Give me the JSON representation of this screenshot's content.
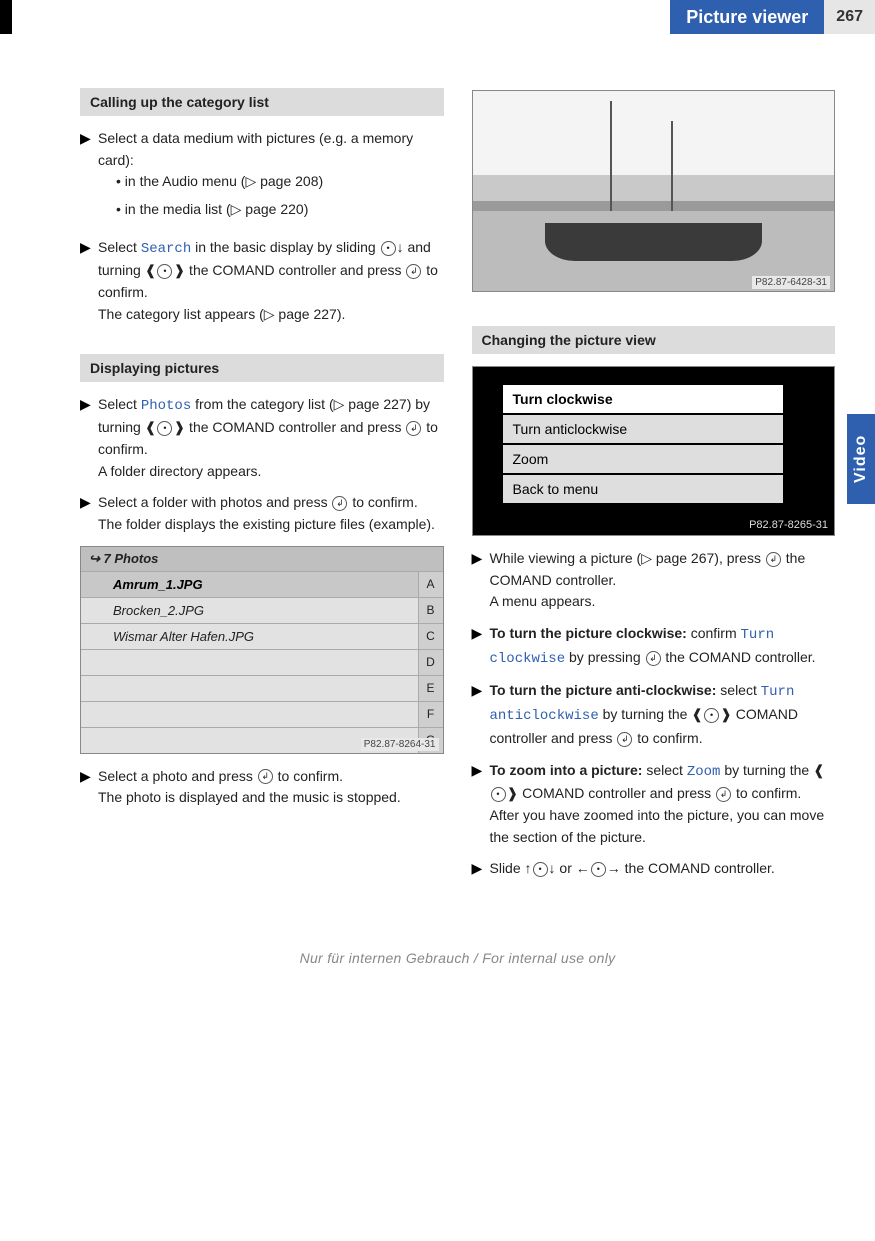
{
  "header": {
    "title": "Picture viewer",
    "page_number": "267"
  },
  "side_tab": "Video",
  "left": {
    "sec1": {
      "heading": "Calling up the category list",
      "step1a": "Select a data medium with pictures (e.g. a memory card):",
      "bullet1": "in the Audio menu (",
      "bullet1_ref": "page 208",
      "bullet2": "in the media list (",
      "bullet2_ref": "page 220",
      "step2_pre": "Select ",
      "step2_menu": "Search",
      "step2_post": " in the basic display by slid­ing ",
      "step2_post2": " and turning ",
      "step2_post3": " the COMAND controller and press ",
      "step2_post4": " to confirm.",
      "step2_result_pre": "The category list appears (",
      "step2_result_ref": "page 227",
      "step2_result_post": ")."
    },
    "sec2": {
      "heading": "Displaying pictures",
      "s1_pre": "Select ",
      "s1_menu": "Photos",
      "s1_mid": " from the category list (",
      "s1_ref": "page 227",
      "s1_post": ") by turning ",
      "s1_post2": " the COMAND controller and press ",
      "s1_post3": " to confirm.",
      "s1_res": "A folder directory appears.",
      "s2": "Select a folder with photos and press ",
      "s2_post": " to confirm.",
      "s2_res": "The folder displays the existing picture files (example).",
      "shot_caption": "P82.87-8264-31",
      "list_header": "7 Photos",
      "files": [
        "Amrum_1.JPG",
        "Brocken_2.JPG",
        "Wismar Alter Hafen.JPG"
      ],
      "letters": [
        "A",
        "B",
        "C",
        "D",
        "E",
        "F",
        "G"
      ],
      "s3": "Select a photo and press ",
      "s3_post": " to confirm.",
      "s3_res": "The photo is displayed and the music is stopped."
    }
  },
  "right": {
    "shot1_caption": "P82.87-6428-31",
    "sec": {
      "heading": "Changing the picture view",
      "menu_items": [
        "Turn clockwise",
        "Turn anticlockwise",
        "Zoom",
        "Back to menu"
      ],
      "shot2_caption": "P82.87-8265-31",
      "s1_pre": "While viewing a picture (",
      "s1_ref": "page 267",
      "s1_post": "), press ",
      "s1_post2": " the COMAND controller.",
      "s1_res": "A menu appears.",
      "s2_bold": "To turn the picture clockwise:",
      "s2_rest": " confirm ",
      "s2_menu": "Turn clockwise",
      "s2_post": " by pressing ",
      "s2_post2": " the COMAND controller.",
      "s3_bold": "To turn the picture anti-clockwise:",
      "s3_rest": " select ",
      "s3_menu": "Turn anticlockwise",
      "s3_post": " by turning the ",
      "s3_post2": " COMAND controller and press ",
      "s3_post3": " to confirm.",
      "s4_bold": "To zoom into a picture:",
      "s4_rest": " select ",
      "s4_menu": "Zoom",
      "s4_post": " by turning the ",
      "s4_post2": " COMAND controller and press ",
      "s4_post3": " to confirm.",
      "s4_res": "After you have zoomed into the picture, you can move the section of the picture.",
      "s5": "Slide ",
      "s5_mid": " or ",
      "s5_post": " the COMAND control­ler."
    }
  },
  "footer": "Nur für internen Gebrauch / For internal use only"
}
